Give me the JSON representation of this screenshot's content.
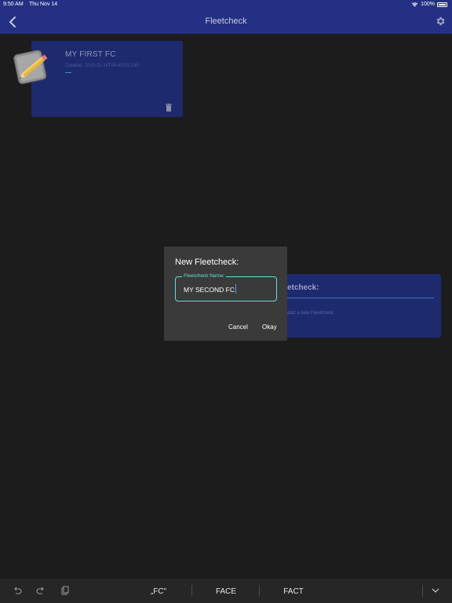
{
  "status_bar": {
    "time": "9:50 AM",
    "date": "Thu Nov 14",
    "battery": "100%"
  },
  "nav": {
    "title": "Fleetcheck"
  },
  "cards": [
    {
      "name": "MY FIRST FC",
      "created": "Created: 2019-11-14T09:49:53.230"
    }
  ],
  "new_card": {
    "heading": "etcheck:",
    "description": "o start a new Fleetcheck."
  },
  "dialog": {
    "title": "New Fleetcheck:",
    "field_label": "Fleetcheck Name:",
    "field_value": "MY SECOND FC",
    "cancel_label": "Cancel",
    "okay_label": "Okay"
  },
  "keyboard": {
    "suggestions": [
      "„FC\"",
      "FACE",
      "FACT"
    ]
  },
  "colors": {
    "nav_bg": "#233083",
    "card_bg": "#1e2a6e",
    "accent": "#5fe0d6",
    "background": "#1c1c1c"
  }
}
